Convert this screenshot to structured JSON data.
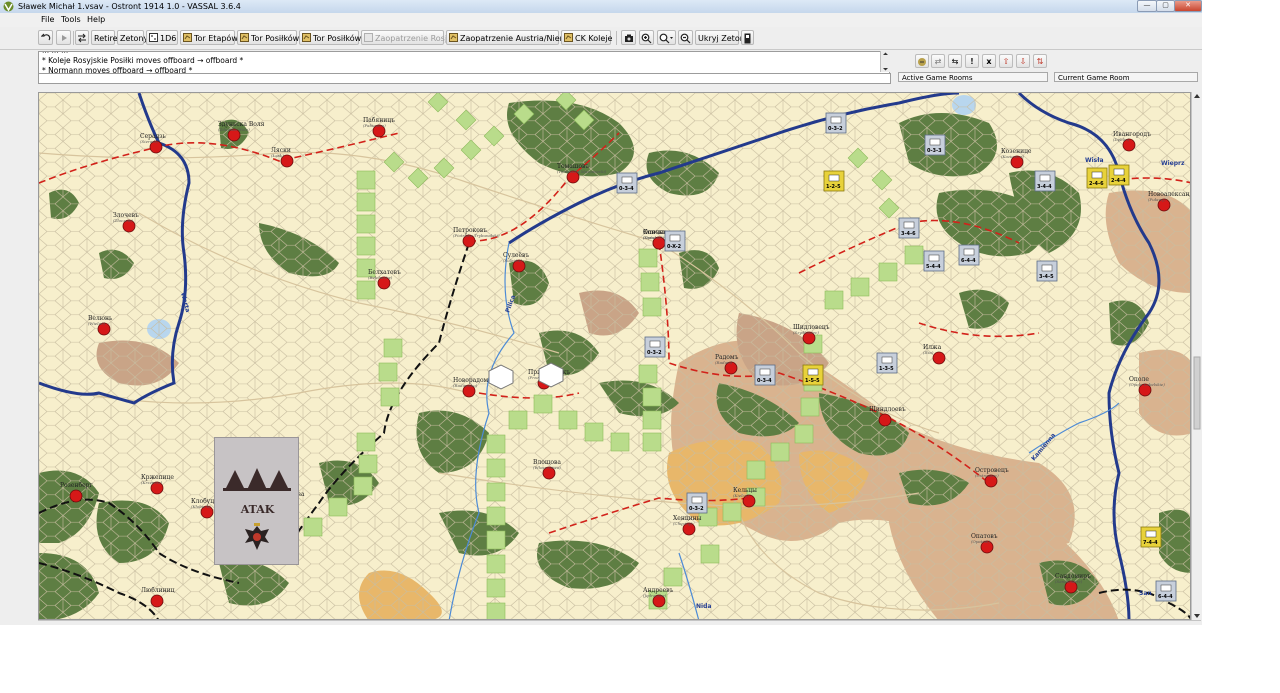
{
  "window": {
    "title": "Sławek Michał 1.vsav - Ostront 1914 1.0 - VASSAL 3.6.4",
    "blurred_suffix": "[blurred text]",
    "controls": [
      "—",
      "▢",
      "✕"
    ]
  },
  "menu": {
    "items": [
      "File",
      "Tools",
      "Help"
    ]
  },
  "toolbar": {
    "retire": "Retire",
    "zetony": "Zetony",
    "die": "1D6",
    "tor_etapow": "Tor Etapów",
    "tor_posilkow": "Tor Posiłków",
    "tor_posilkow2": "Tor Posiłków",
    "zaopatrzenie_rosja": "Zaopatrzenie Rosja",
    "zaopatrzenie_austria": "Zaopatrzenie Austria/Niemcy",
    "ck_koleje": "CK Koleje",
    "ukryj_zetony": "Ukryj Zetony"
  },
  "chat": {
    "lines": [
      "* Koleje Rosyjskie Posiłki moves offboard → offboard *",
      "* Normann moves offboard → offboard *"
    ],
    "partial_top": "... ... ..."
  },
  "server": {
    "active_rooms": "Active Game Rooms",
    "current_room": "Current Game Room",
    "buttons": [
      "↺",
      "⇄",
      "⇆",
      "!",
      "x",
      "⇧",
      "⇩",
      "⇅"
    ]
  },
  "map": {
    "towns": [
      {
        "name": "Серадзь",
        "sub": "(Sieradz)"
      },
      {
        "name": "Здуньска Воля",
        "sub": "(Zduńska Wola)"
      },
      {
        "name": "Ляски",
        "sub": "(Łask)"
      },
      {
        "name": "Пабяницъ",
        "sub": "(Pabianice)"
      },
      {
        "name": "Томашовъ",
        "sub": "(Tomaszów Mazowiecki)"
      },
      {
        "name": "Злочевъ",
        "sub": "(Złoczew)"
      },
      {
        "name": "Петроковъ",
        "sub": "(Piotrków Trybunalski)"
      },
      {
        "name": "Сулеёвъ",
        "sub": "(Sulejów)"
      },
      {
        "name": "Опочно",
        "sub": "(Opoczno)"
      },
      {
        "name": "Велюнь",
        "sub": "(Wieluń)"
      },
      {
        "name": "Белхатовъ",
        "sub": "(Bełchatów)"
      },
      {
        "name": "Новорадомскъ",
        "sub": "(Radomsko)"
      },
      {
        "name": "Пржедборжъ",
        "sub": "(Przedbórz)"
      },
      {
        "name": "Кржепице",
        "sub": "(Krzepice)"
      },
      {
        "name": "Клобуцко",
        "sub": "(Kłobuck)"
      },
      {
        "name": "Ченстохова",
        "sub": "(Częstochowa)"
      },
      {
        "name": "Влощова",
        "sub": "(Włoszczowa)"
      },
      {
        "name": "Хенцины",
        "sub": "(Chęciny)"
      },
      {
        "name": "Кельцы",
        "sub": "(Kielce)"
      },
      {
        "name": "Конскъ",
        "sub": "(Końskie)"
      },
      {
        "name": "Шидловецъ",
        "sub": "(Szydłowiec)"
      },
      {
        "name": "Радомъ",
        "sub": "(Radom)"
      },
      {
        "name": "Ивангородъ",
        "sub": "(Dęblin)"
      },
      {
        "name": "Козенице",
        "sub": "(Kozienice)"
      },
      {
        "name": "Новоалександрия",
        "sub": "(Puławy)"
      },
      {
        "name": "Илжа",
        "sub": "(Iłża)"
      },
      {
        "name": "Островецъ",
        "sub": "(Ostrowiec)"
      },
      {
        "name": "Ополе",
        "sub": "(Opole Lubelskie)"
      },
      {
        "name": "Опатовъ",
        "sub": "(Opatów)"
      },
      {
        "name": "Сандомиръ",
        "sub": "(Sandomierz)"
      },
      {
        "name": "Андреевъ",
        "sub": "(Jędrzejów)"
      },
      {
        "name": "Розенберг",
        "sub": ""
      },
      {
        "name": "Люблиниц",
        "sub": ""
      },
      {
        "name": "Шиндлоевъ",
        "sub": ""
      }
    ],
    "rivers": [
      "Warta",
      "Pilica",
      "Wisła",
      "Wieprz",
      "Nida",
      "Kamienna",
      "San"
    ],
    "counters": [
      {
        "label": "0-3-2",
        "side": "ru"
      },
      {
        "label": "0-3-4",
        "side": "ru"
      },
      {
        "label": "1-2-5",
        "side": "au"
      },
      {
        "label": "0-3-3",
        "side": "ru"
      },
      {
        "label": "0-X-2",
        "side": "ru"
      },
      {
        "label": "3-4-4",
        "side": "ru"
      },
      {
        "label": "3-4-5",
        "side": "ru"
      },
      {
        "label": "2-4-6",
        "side": "au"
      },
      {
        "label": "2-4-4",
        "side": "au"
      },
      {
        "label": "6-4-4",
        "side": "ru"
      },
      {
        "label": "5-4-4",
        "side": "ru"
      },
      {
        "label": "1-5-5",
        "side": "au"
      },
      {
        "label": "0-3-4",
        "side": "ru"
      },
      {
        "label": "0-3-2",
        "side": "ru"
      },
      {
        "label": "0-3-2",
        "side": "ru"
      },
      {
        "label": "7-4-4",
        "side": "au"
      },
      {
        "label": "6-4-4",
        "side": "ru"
      },
      {
        "label": "1-3-5",
        "side": "ru"
      },
      {
        "label": "3-4-6",
        "side": "ru"
      }
    ]
  },
  "card": {
    "title": "ATAK"
  },
  "colors": {
    "map_bg": "#f7efcc",
    "hex_line": "#c8bda0",
    "forest": "#5e7e43",
    "hills": "#c9a487",
    "highland": "#e8b76a",
    "river": "#233a8c",
    "rail": "#d2221a",
    "town": "#d61818",
    "track_green": "#b9dc8b"
  }
}
